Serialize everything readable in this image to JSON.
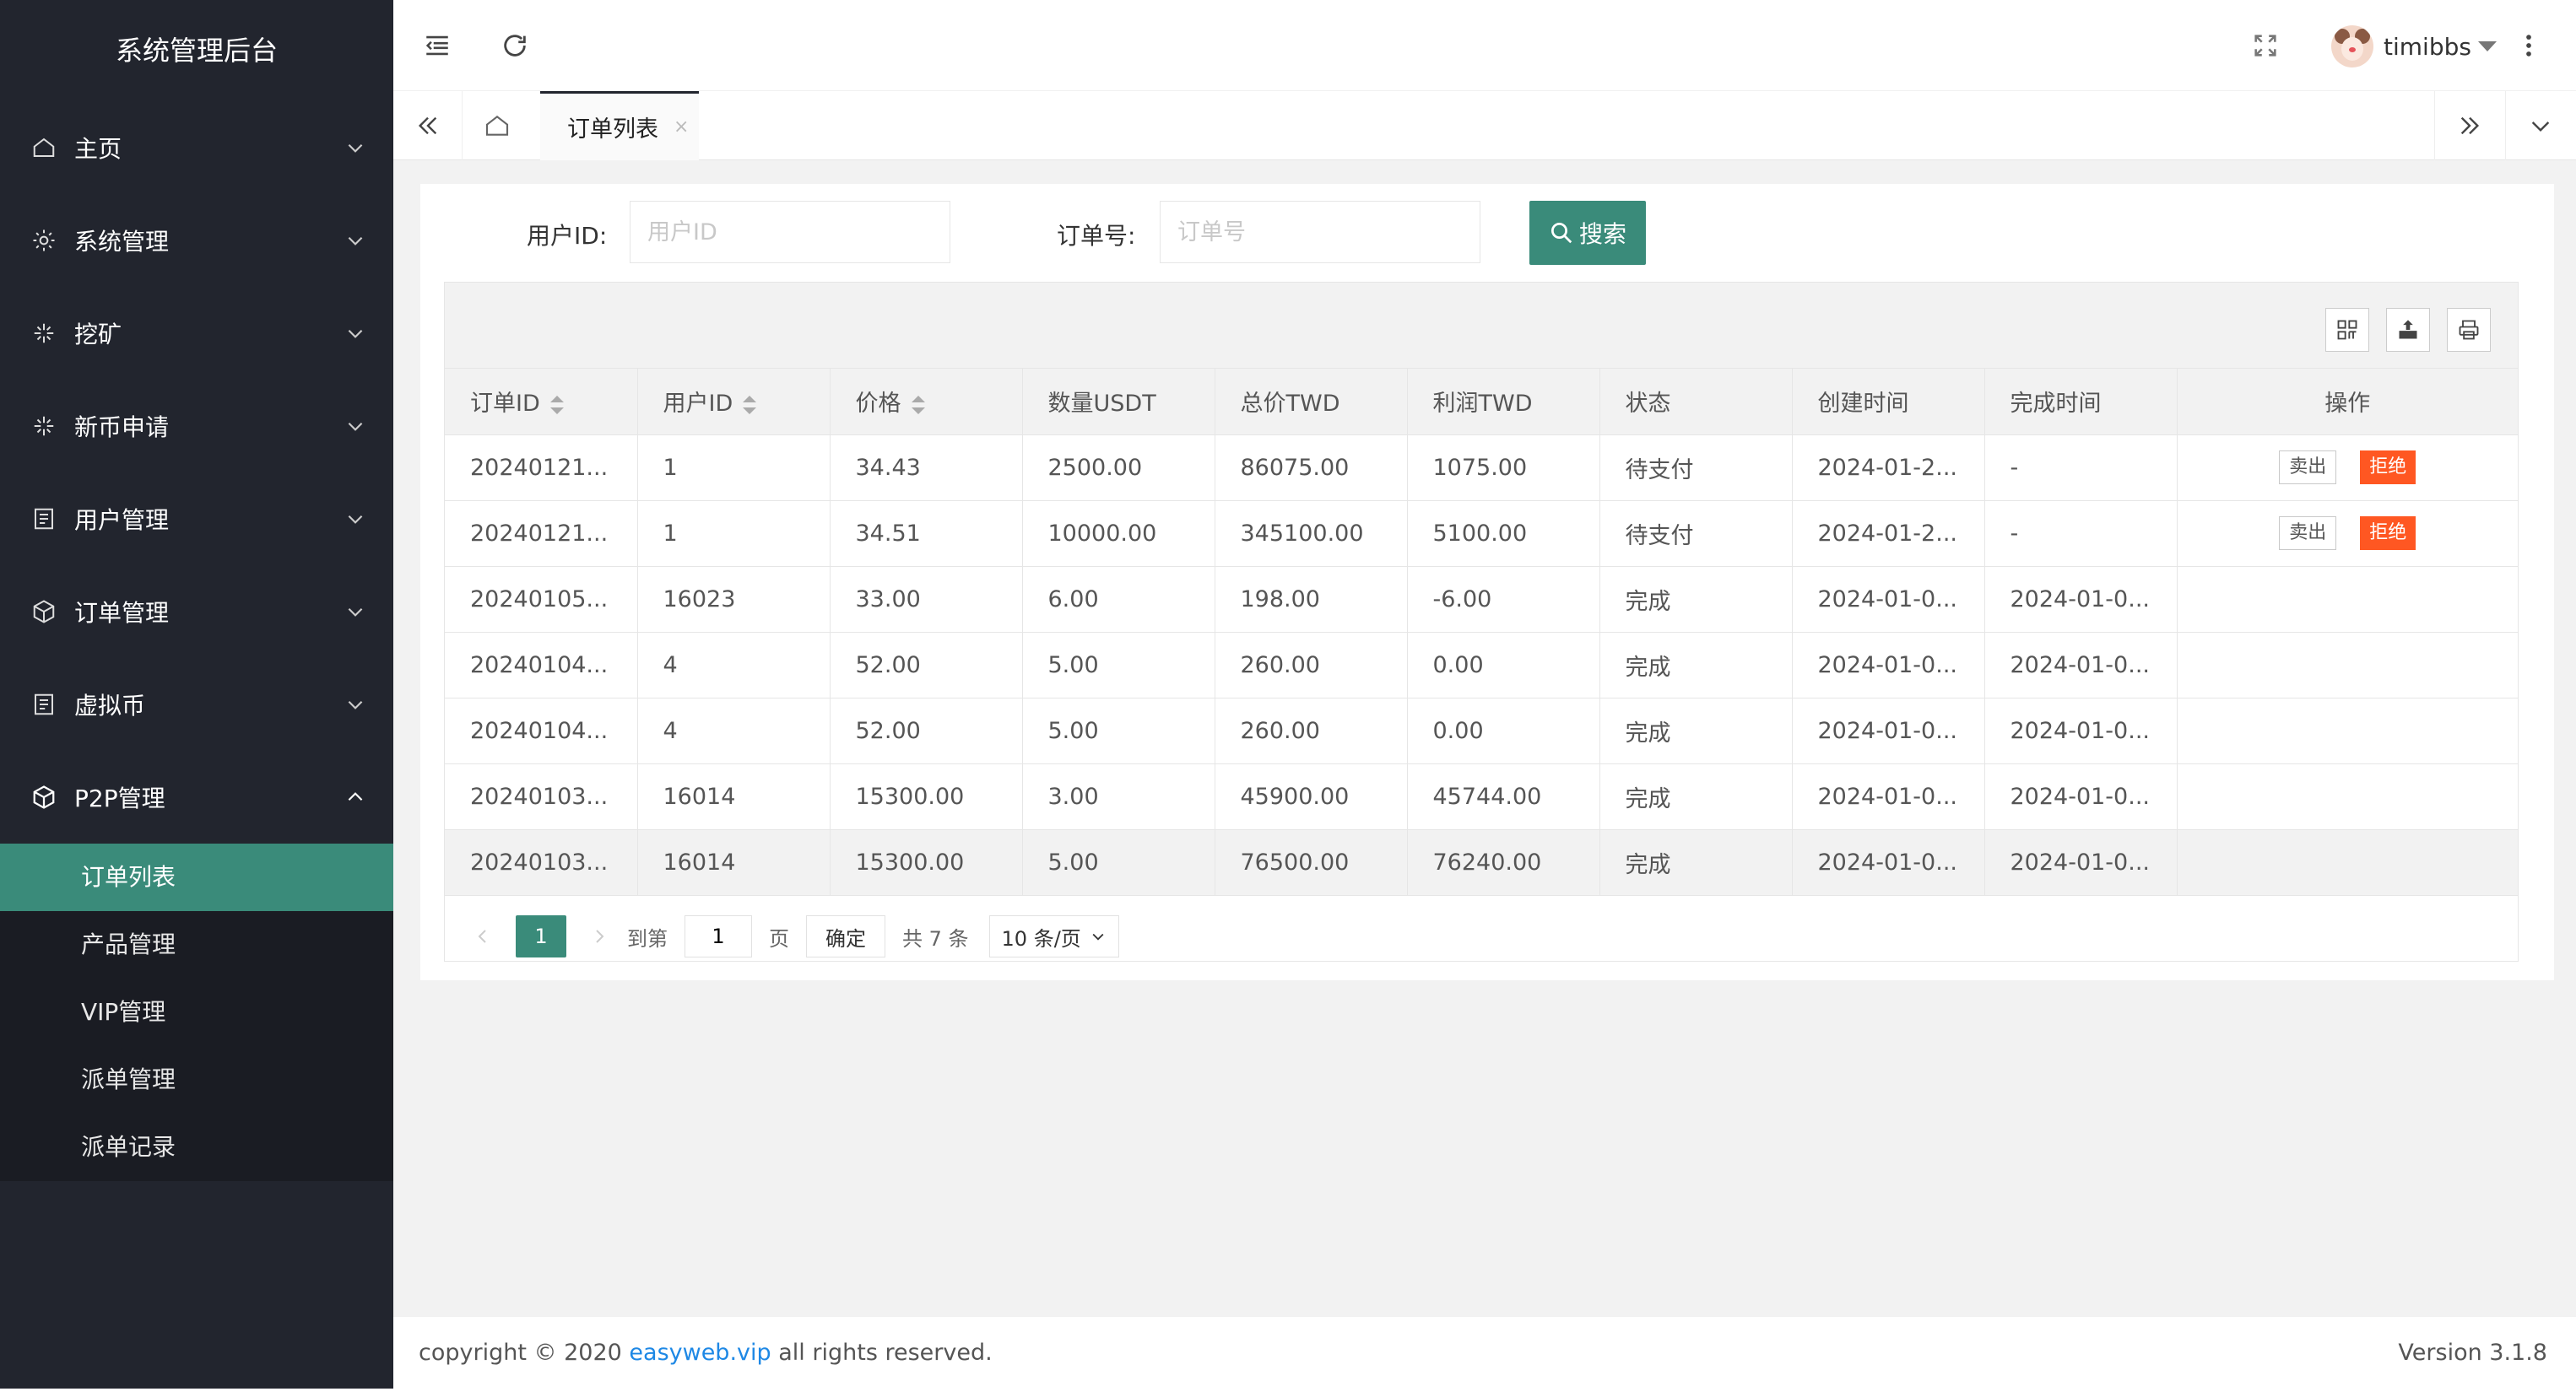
{
  "sidebar": {
    "brand": "系统管理后台",
    "menu": [
      {
        "label": "主页",
        "icon": "home-icon"
      },
      {
        "label": "系统管理",
        "icon": "gear-icon"
      },
      {
        "label": "挖矿",
        "icon": "sparkle-icon"
      },
      {
        "label": "新币申请",
        "icon": "sparkle-icon"
      },
      {
        "label": "用户管理",
        "icon": "document-icon"
      },
      {
        "label": "订单管理",
        "icon": "cube-icon"
      },
      {
        "label": "虚拟币",
        "icon": "document-icon"
      },
      {
        "label": "P2P管理",
        "icon": "cube-icon"
      }
    ],
    "submenu": [
      "订单列表",
      "产品管理",
      "VIP管理",
      "派单管理",
      "派单记录"
    ]
  },
  "header": {
    "username": "timibbs"
  },
  "tabs": {
    "active": "订单列表",
    "close": "×"
  },
  "filters": {
    "user_id_label": "用户ID:",
    "user_id_placeholder": "用户ID",
    "order_no_label": "订单号:",
    "order_no_placeholder": "订单号",
    "search_label": "搜索"
  },
  "table": {
    "columns": [
      "订单ID",
      "用户ID",
      "价格",
      "数量USDT",
      "总价TWD",
      "利润TWD",
      "状态",
      "创建时间",
      "完成时间",
      "操作"
    ],
    "rows": [
      {
        "id": "20240121...",
        "user": "1",
        "price": "34.43",
        "qty": "2500.00",
        "total": "86075.00",
        "profit": "1075.00",
        "status": "待支付",
        "created": "2024-01-2...",
        "done": "-"
      },
      {
        "id": "20240121...",
        "user": "1",
        "price": "34.51",
        "qty": "10000.00",
        "total": "345100.00",
        "profit": "5100.00",
        "status": "待支付",
        "created": "2024-01-2...",
        "done": "-"
      },
      {
        "id": "20240105...",
        "user": "16023",
        "price": "33.00",
        "qty": "6.00",
        "total": "198.00",
        "profit": "-6.00",
        "status": "完成",
        "created": "2024-01-0...",
        "done": "2024-01-0..."
      },
      {
        "id": "20240104...",
        "user": "4",
        "price": "52.00",
        "qty": "5.00",
        "total": "260.00",
        "profit": "0.00",
        "status": "完成",
        "created": "2024-01-0...",
        "done": "2024-01-0..."
      },
      {
        "id": "20240104...",
        "user": "4",
        "price": "52.00",
        "qty": "5.00",
        "total": "260.00",
        "profit": "0.00",
        "status": "完成",
        "created": "2024-01-0...",
        "done": "2024-01-0..."
      },
      {
        "id": "20240103...",
        "user": "16014",
        "price": "15300.00",
        "qty": "3.00",
        "total": "45900.00",
        "profit": "45744.00",
        "status": "完成",
        "created": "2024-01-0...",
        "done": "2024-01-0..."
      },
      {
        "id": "20240103...",
        "user": "16014",
        "price": "15300.00",
        "qty": "5.00",
        "total": "76500.00",
        "profit": "76240.00",
        "status": "完成",
        "created": "2024-01-0...",
        "done": "2024-01-0..."
      }
    ],
    "sell_label": "卖出",
    "reject_label": "拒绝"
  },
  "pager": {
    "current": "1",
    "goto_label": "到第",
    "page_input": "1",
    "page_unit": "页",
    "confirm": "确定",
    "total": "共 7 条",
    "page_size": "10 条/页"
  },
  "footer": {
    "copyright_prefix": "copyright © 2020",
    "link_text": "easyweb.vip",
    "copyright_suffix": "all rights reserved.",
    "version": "Version 3.1.8"
  },
  "colors": {
    "sidebar_bg": "#22252e",
    "accent": "#3a8b7a",
    "danger": "#ff5722",
    "link": "#1e88e5"
  }
}
